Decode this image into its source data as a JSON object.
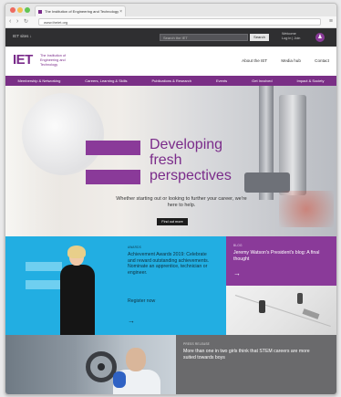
{
  "browser": {
    "tab_title": "The Institution of Engineering and Technology",
    "tab_close": "×",
    "url": "www.theiet.org",
    "icons": [
      "back-icon",
      "forward-icon",
      "reload-icon",
      "menu-icon"
    ]
  },
  "utility": {
    "left_text": "IET sites ↓",
    "search_placeholder": "Search the IET",
    "search_button": "Search",
    "welcome_line1": "Welcome",
    "welcome_line2": "Log in | Join",
    "account_glyph": "♟"
  },
  "header": {
    "logo": "IET",
    "logo_text": "The Institution of Engineering and Technology",
    "links": [
      "About the IET",
      "Media hub",
      "Contact"
    ]
  },
  "nav": {
    "items": [
      "Membership & Networking",
      "Careers, Learning & Skills",
      "Publications & Research",
      "Events",
      "Get Involved",
      "Impact & Society"
    ]
  },
  "hero": {
    "title_line1": "Developing",
    "title_line2": "fresh",
    "title_line3": "perspectives",
    "subtitle": "Whether starting out or looking to further your career, we're here to help.",
    "button": "Find out more"
  },
  "promos": {
    "awards": {
      "label": "AWARDS",
      "title": "Achievement Awards 2019: Celebrate and reward outstanding achievements. Nominate an apprentice, technician or engineer.",
      "link": "Register now",
      "arrow": "→"
    },
    "blog": {
      "label": "BLOG",
      "title": "Jeremy Watson's President's blog: A final thought",
      "arrow": "→"
    },
    "press": {
      "label": "PRESS RELEASE",
      "title": "More than one in two girls think that STEM careers are more suited towards boys"
    }
  },
  "colors": {
    "brand_purple": "#7a2b8a",
    "accent_blue": "#22aee2",
    "dark_bar": "#2f2f31",
    "grey_panel": "#6a6a6c"
  }
}
